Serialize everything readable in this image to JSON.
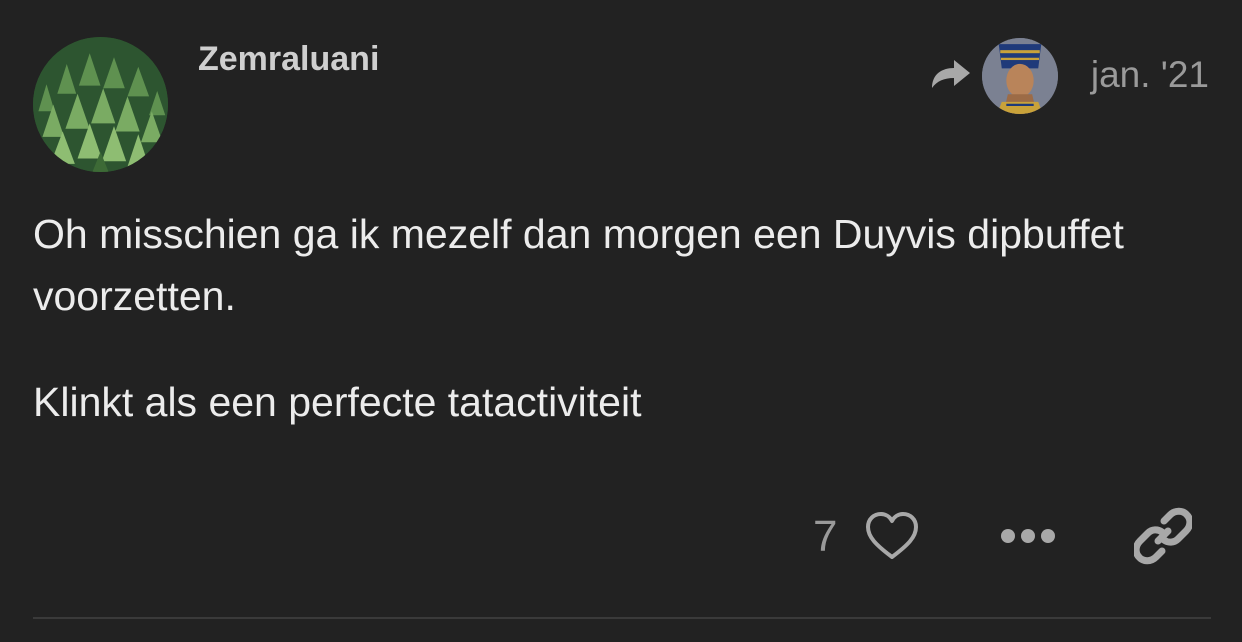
{
  "post": {
    "username": "Zemraluani",
    "date": "jan. '21",
    "body": {
      "paragraph_1": "Oh misschien ga ik mezelf dan morgen een Duyvis dipbuffet voorzetten.",
      "paragraph_2": "Klinkt als een perfecte tatactiviteit"
    },
    "likes": "7",
    "icons": {
      "reply": "reply-arrow-icon",
      "like": "heart-icon",
      "more": "ellipsis-icon",
      "share": "link-icon"
    }
  },
  "colors": {
    "background": "#222222",
    "text": "#ececec",
    "muted": "#9a9a9a",
    "divider": "#3a3a3a"
  }
}
